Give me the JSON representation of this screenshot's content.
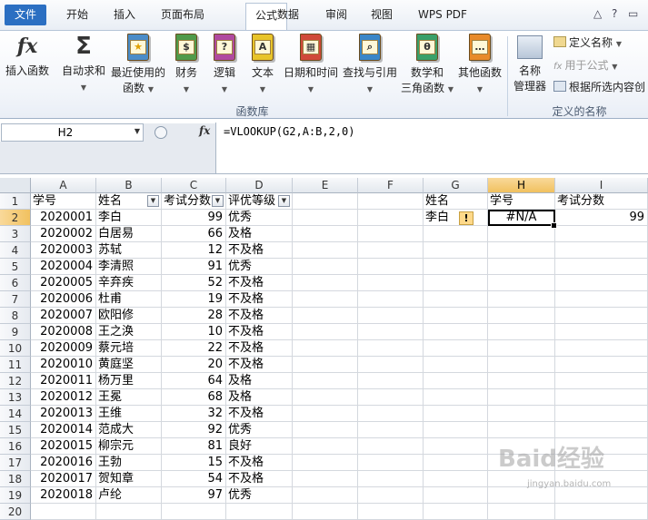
{
  "menu": {
    "file": "文件",
    "tabs": [
      "开始",
      "插入",
      "页面布局",
      "公式",
      "数据",
      "审阅",
      "视图",
      "WPS PDF"
    ],
    "active_tab": "公式"
  },
  "ribbon": {
    "buttons": {
      "insert_function": "插入函数",
      "autosum": "自动求和",
      "recently_used_1": "最近使用的",
      "recently_used_2": "函数",
      "financial": "财务",
      "logical": "逻辑",
      "text": "文本",
      "datetime": "日期和时间",
      "lookup": "查找与引用",
      "math_1": "数学和",
      "math_2": "三角函数",
      "more": "其他函数",
      "name_manager_1": "名称",
      "name_manager_2": "管理器"
    },
    "small": {
      "define_name": "定义名称",
      "use_in_formula": "用于公式",
      "create_from_selection": "根据所选内容创"
    },
    "groups": {
      "function_library": "函数库",
      "defined_names": "定义的名称"
    }
  },
  "formula_bar": {
    "name_box": "H2",
    "fx": "fx",
    "formula": "=VLOOKUP(G2,A:B,2,0)"
  },
  "sheet": {
    "columns": [
      "A",
      "B",
      "C",
      "D",
      "E",
      "F",
      "G",
      "H",
      "I"
    ],
    "headers": {
      "A": "学号",
      "B": "姓名",
      "C": "考试分数",
      "D": "评优等级"
    },
    "rows": [
      {
        "id": "2020001",
        "name": "李白",
        "score": "99",
        "grade": "优秀"
      },
      {
        "id": "2020002",
        "name": "白居易",
        "score": "66",
        "grade": "及格"
      },
      {
        "id": "2020003",
        "name": "苏轼",
        "score": "12",
        "grade": "不及格"
      },
      {
        "id": "2020004",
        "name": "李清照",
        "score": "91",
        "grade": "优秀"
      },
      {
        "id": "2020005",
        "name": "辛弃疾",
        "score": "52",
        "grade": "不及格"
      },
      {
        "id": "2020006",
        "name": "杜甫",
        "score": "19",
        "grade": "不及格"
      },
      {
        "id": "2020007",
        "name": "欧阳修",
        "score": "28",
        "grade": "不及格"
      },
      {
        "id": "2020008",
        "name": "王之涣",
        "score": "10",
        "grade": "不及格"
      },
      {
        "id": "2020009",
        "name": "蔡元培",
        "score": "22",
        "grade": "不及格"
      },
      {
        "id": "2020010",
        "name": "黄庭坚",
        "score": "20",
        "grade": "不及格"
      },
      {
        "id": "2020011",
        "name": "杨万里",
        "score": "64",
        "grade": "及格"
      },
      {
        "id": "2020012",
        "name": "王冕",
        "score": "68",
        "grade": "及格"
      },
      {
        "id": "2020013",
        "name": "王维",
        "score": "32",
        "grade": "不及格"
      },
      {
        "id": "2020014",
        "name": "范成大",
        "score": "92",
        "grade": "优秀"
      },
      {
        "id": "2020015",
        "name": "柳宗元",
        "score": "81",
        "grade": "良好"
      },
      {
        "id": "2020016",
        "name": "王勃",
        "score": "15",
        "grade": "不及格"
      },
      {
        "id": "2020017",
        "name": "贺知章",
        "score": "54",
        "grade": "不及格"
      },
      {
        "id": "2020018",
        "name": "卢纶",
        "score": "97",
        "grade": "优秀"
      }
    ],
    "lookup": {
      "g1": "姓名",
      "h1": "学号",
      "i1": "考试分数",
      "g2": "李白",
      "h2": "#N/A",
      "i2": "99"
    }
  },
  "watermark": {
    "main": "Baid经验",
    "sub": "jingyan.baidu.com"
  }
}
